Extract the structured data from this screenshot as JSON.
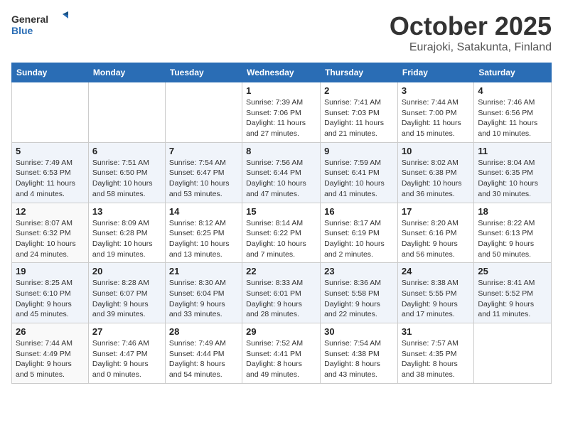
{
  "header": {
    "logo_general": "General",
    "logo_blue": "Blue",
    "month": "October 2025",
    "location": "Eurajoki, Satakunta, Finland"
  },
  "days_of_week": [
    "Sunday",
    "Monday",
    "Tuesday",
    "Wednesday",
    "Thursday",
    "Friday",
    "Saturday"
  ],
  "weeks": [
    [
      {
        "day": "",
        "sunrise": "",
        "sunset": "",
        "daylight": ""
      },
      {
        "day": "",
        "sunrise": "",
        "sunset": "",
        "daylight": ""
      },
      {
        "day": "",
        "sunrise": "",
        "sunset": "",
        "daylight": ""
      },
      {
        "day": "1",
        "sunrise": "7:39 AM",
        "sunset": "7:06 PM",
        "daylight": "11 hours and 27 minutes."
      },
      {
        "day": "2",
        "sunrise": "7:41 AM",
        "sunset": "7:03 PM",
        "daylight": "11 hours and 21 minutes."
      },
      {
        "day": "3",
        "sunrise": "7:44 AM",
        "sunset": "7:00 PM",
        "daylight": "11 hours and 15 minutes."
      },
      {
        "day": "4",
        "sunrise": "7:46 AM",
        "sunset": "6:56 PM",
        "daylight": "11 hours and 10 minutes."
      }
    ],
    [
      {
        "day": "5",
        "sunrise": "7:49 AM",
        "sunset": "6:53 PM",
        "daylight": "11 hours and 4 minutes."
      },
      {
        "day": "6",
        "sunrise": "7:51 AM",
        "sunset": "6:50 PM",
        "daylight": "10 hours and 58 minutes."
      },
      {
        "day": "7",
        "sunrise": "7:54 AM",
        "sunset": "6:47 PM",
        "daylight": "10 hours and 53 minutes."
      },
      {
        "day": "8",
        "sunrise": "7:56 AM",
        "sunset": "6:44 PM",
        "daylight": "10 hours and 47 minutes."
      },
      {
        "day": "9",
        "sunrise": "7:59 AM",
        "sunset": "6:41 PM",
        "daylight": "10 hours and 41 minutes."
      },
      {
        "day": "10",
        "sunrise": "8:02 AM",
        "sunset": "6:38 PM",
        "daylight": "10 hours and 36 minutes."
      },
      {
        "day": "11",
        "sunrise": "8:04 AM",
        "sunset": "6:35 PM",
        "daylight": "10 hours and 30 minutes."
      }
    ],
    [
      {
        "day": "12",
        "sunrise": "8:07 AM",
        "sunset": "6:32 PM",
        "daylight": "10 hours and 24 minutes."
      },
      {
        "day": "13",
        "sunrise": "8:09 AM",
        "sunset": "6:28 PM",
        "daylight": "10 hours and 19 minutes."
      },
      {
        "day": "14",
        "sunrise": "8:12 AM",
        "sunset": "6:25 PM",
        "daylight": "10 hours and 13 minutes."
      },
      {
        "day": "15",
        "sunrise": "8:14 AM",
        "sunset": "6:22 PM",
        "daylight": "10 hours and 7 minutes."
      },
      {
        "day": "16",
        "sunrise": "8:17 AM",
        "sunset": "6:19 PM",
        "daylight": "10 hours and 2 minutes."
      },
      {
        "day": "17",
        "sunrise": "8:20 AM",
        "sunset": "6:16 PM",
        "daylight": "9 hours and 56 minutes."
      },
      {
        "day": "18",
        "sunrise": "8:22 AM",
        "sunset": "6:13 PM",
        "daylight": "9 hours and 50 minutes."
      }
    ],
    [
      {
        "day": "19",
        "sunrise": "8:25 AM",
        "sunset": "6:10 PM",
        "daylight": "9 hours and 45 minutes."
      },
      {
        "day": "20",
        "sunrise": "8:28 AM",
        "sunset": "6:07 PM",
        "daylight": "9 hours and 39 minutes."
      },
      {
        "day": "21",
        "sunrise": "8:30 AM",
        "sunset": "6:04 PM",
        "daylight": "9 hours and 33 minutes."
      },
      {
        "day": "22",
        "sunrise": "8:33 AM",
        "sunset": "6:01 PM",
        "daylight": "9 hours and 28 minutes."
      },
      {
        "day": "23",
        "sunrise": "8:36 AM",
        "sunset": "5:58 PM",
        "daylight": "9 hours and 22 minutes."
      },
      {
        "day": "24",
        "sunrise": "8:38 AM",
        "sunset": "5:55 PM",
        "daylight": "9 hours and 17 minutes."
      },
      {
        "day": "25",
        "sunrise": "8:41 AM",
        "sunset": "5:52 PM",
        "daylight": "9 hours and 11 minutes."
      }
    ],
    [
      {
        "day": "26",
        "sunrise": "7:44 AM",
        "sunset": "4:49 PM",
        "daylight": "9 hours and 5 minutes."
      },
      {
        "day": "27",
        "sunrise": "7:46 AM",
        "sunset": "4:47 PM",
        "daylight": "9 hours and 0 minutes."
      },
      {
        "day": "28",
        "sunrise": "7:49 AM",
        "sunset": "4:44 PM",
        "daylight": "8 hours and 54 minutes."
      },
      {
        "day": "29",
        "sunrise": "7:52 AM",
        "sunset": "4:41 PM",
        "daylight": "8 hours and 49 minutes."
      },
      {
        "day": "30",
        "sunrise": "7:54 AM",
        "sunset": "4:38 PM",
        "daylight": "8 hours and 43 minutes."
      },
      {
        "day": "31",
        "sunrise": "7:57 AM",
        "sunset": "4:35 PM",
        "daylight": "8 hours and 38 minutes."
      },
      {
        "day": "",
        "sunrise": "",
        "sunset": "",
        "daylight": ""
      }
    ]
  ],
  "labels": {
    "sunrise_prefix": "Sunrise: ",
    "sunset_prefix": "Sunset: ",
    "daylight_prefix": "Daylight: "
  }
}
